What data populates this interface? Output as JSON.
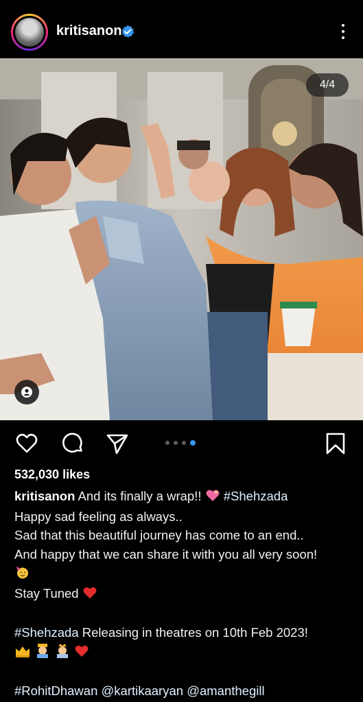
{
  "header": {
    "username": "kritisanon",
    "verified": true,
    "avatar_icon": "profile-avatar",
    "more_icon": "vertical-ellipsis-icon"
  },
  "post": {
    "media_counter": "4/4",
    "current_slide": 4,
    "total_slides": 4,
    "tag_icon": "user-tag-icon"
  },
  "actions": {
    "like_icon": "heart-outline-icon",
    "comment_icon": "comment-bubble-icon",
    "share_icon": "paper-plane-icon",
    "save_icon": "bookmark-outline-icon"
  },
  "likes": "532,030 likes",
  "caption": {
    "author": "kritisanon",
    "line1_text": " And its finally a wrap!! ",
    "line1_hashtag": "#Shehzada",
    "line2": "Happy sad feeling as always..",
    "line3": "Sad that this beautiful journey has come to an end..",
    "line4": "And happy that we can share it with you all very soon!",
    "line6_text": "Stay Tuned ",
    "line7_hashtag": "#Shehzada",
    "line7_text": " Releasing in theatres on 10th Feb 2023!",
    "line9_tag1": "#RohitDhawan",
    "line9_mention1": "@kartikaaryan",
    "line9_mention2": "@amanthegill"
  },
  "colors": {
    "background": "#000000",
    "text": "#f5f5f5",
    "accent_dot": "#3897f0",
    "verified_badge": "#3897f0"
  }
}
